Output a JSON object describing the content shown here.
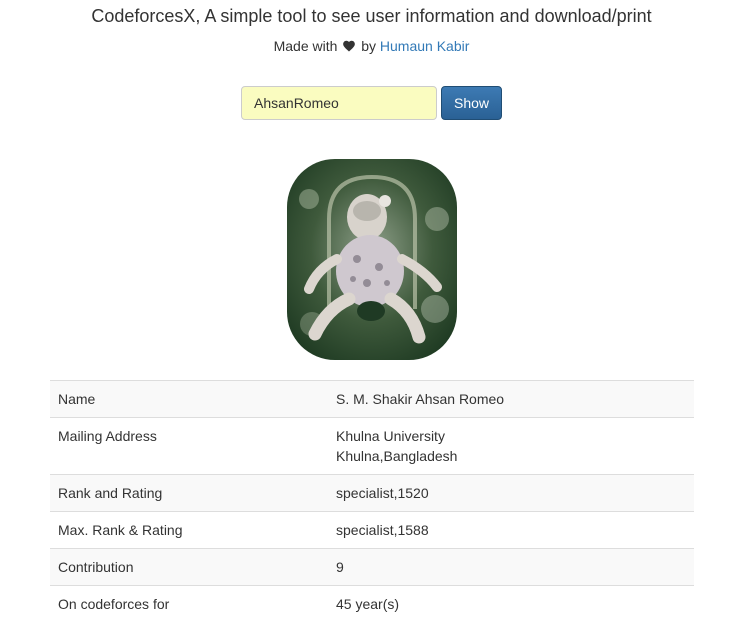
{
  "header": {
    "title": "CodeforcesX, A simple tool to see user information and download/print",
    "made_with": "Made with",
    "by": "by",
    "author": "Humaun Kabir"
  },
  "search": {
    "handle_value": "AhsanRomeo",
    "show_label": "Show"
  },
  "profile": {
    "rows": [
      {
        "label": "Name",
        "value": "S. M. Shakir Ahsan Romeo"
      },
      {
        "label": "Mailing Address",
        "value_line1": "Khulna University",
        "value_line2": "Khulna,Bangladesh"
      },
      {
        "label": "Rank and Rating",
        "value": "specialist,1520"
      },
      {
        "label": "Max. Rank & Rating",
        "value": "specialist,1588"
      },
      {
        "label": "Contribution",
        "value": "9"
      },
      {
        "label": "On codeforces for",
        "value": "45 year(s)"
      }
    ]
  },
  "colors": {
    "link": "#337ab7",
    "button": "#2a6195",
    "input_bg": "#fafcc0",
    "striped_row": "#f9f9f9"
  }
}
